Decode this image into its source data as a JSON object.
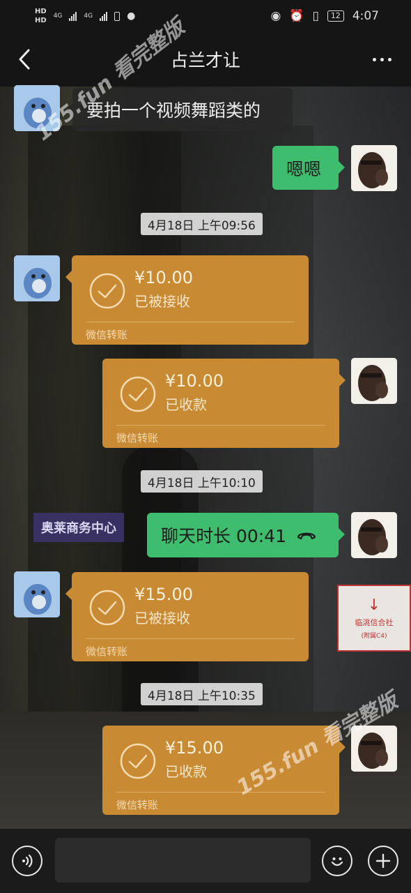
{
  "status_bar": {
    "hd1": "HD",
    "hd2": "HD",
    "net1": "4G",
    "net2": "4G",
    "battery": "12",
    "time": "4:07"
  },
  "header": {
    "title": "占兰才让"
  },
  "messages": {
    "m1_text": "要拍一个视频舞蹈类的",
    "m2_text": "嗯嗯",
    "ts1": "4月18日 上午09:56",
    "t1": {
      "amount": "¥10.00",
      "status": "已被接收",
      "label": "微信转账"
    },
    "t2": {
      "amount": "¥10.00",
      "status": "已收款",
      "label": "微信转账"
    },
    "ts2": "4月18日 上午10:10",
    "call_text": "聊天时长 00:41",
    "t3": {
      "amount": "¥15.00",
      "status": "已被接收",
      "label": "微信转账"
    },
    "ts3": "4月18日 上午10:35",
    "t4": {
      "amount": "¥15.00",
      "status": "已收款",
      "label": "微信转账"
    }
  },
  "background": {
    "sign_text": "奥莱商务中心",
    "poster_line1": "临洮信合社",
    "poster_line2": "(附属C4)"
  },
  "watermark": {
    "text1": "155.fun 看完整版",
    "text2": "155.fun 看完整版"
  },
  "input": {
    "value": ""
  },
  "colors": {
    "green_bubble": "#3fbd6e",
    "transfer_orange": "#c98a34",
    "bar_bg": "#151515"
  },
  "icons": [
    "back-arrow-icon",
    "more-dots-icon",
    "voice-icon",
    "emoji-icon",
    "plus-icon",
    "check-circle-icon",
    "phone-hangup-icon"
  ]
}
